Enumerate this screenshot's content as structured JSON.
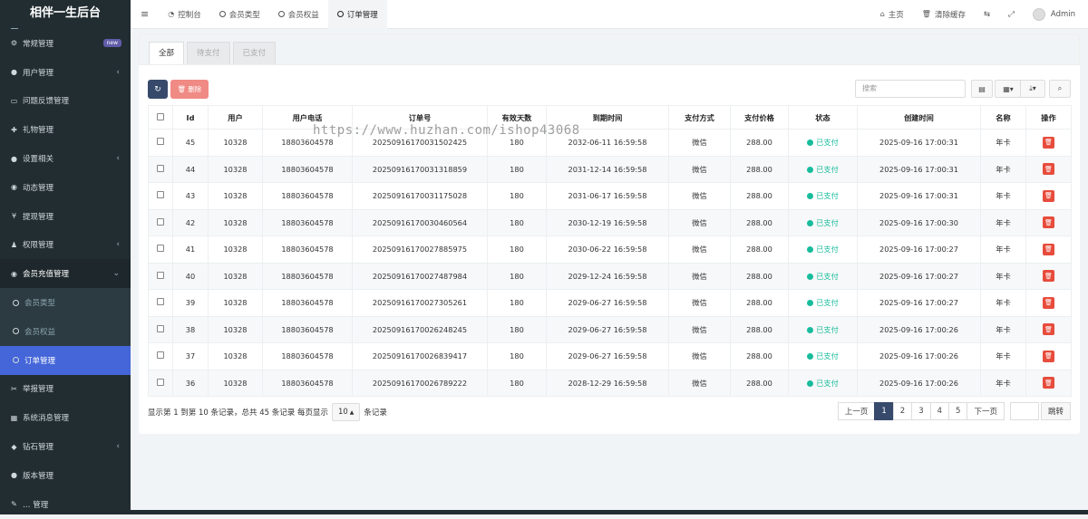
{
  "app_title": "相伴一生后台",
  "sidebar": {
    "items": [
      {
        "label": "常规管理",
        "icon": "gears-icon",
        "badge": "new"
      },
      {
        "label": "用户管理",
        "icon": "user-icon",
        "chev": "‹"
      },
      {
        "label": "问题反馈管理",
        "icon": "feedback-icon"
      },
      {
        "label": "礼物管理",
        "icon": "gift-icon"
      },
      {
        "label": "设置相关",
        "icon": "apple-icon",
        "chev": "‹"
      },
      {
        "label": "动态管理",
        "icon": "compass-icon"
      },
      {
        "label": "提现管理",
        "icon": "yen-icon"
      },
      {
        "label": "权限管理",
        "icon": "group-icon",
        "chev": "‹"
      },
      {
        "label": "会员充值管理",
        "icon": "dot-circle-icon",
        "chev": "⌄"
      }
    ],
    "sub_items": [
      {
        "label": "会员类型"
      },
      {
        "label": "会员权益"
      },
      {
        "label": "订单管理"
      }
    ],
    "items_after": [
      {
        "label": "举报管理",
        "icon": "scissors-icon"
      },
      {
        "label": "系统消息管理",
        "icon": "institution-icon"
      },
      {
        "label": "钻石管理",
        "icon": "diamond-icon",
        "chev": "‹"
      },
      {
        "label": "版本管理",
        "icon": "android-icon"
      },
      {
        "label": "… 管理",
        "icon": "misc-icon"
      }
    ]
  },
  "topbar": {
    "tabs": [
      {
        "label": "控制台",
        "icon": "dashboard-icon"
      },
      {
        "label": "会员类型",
        "icon": "circle-icon"
      },
      {
        "label": "会员权益",
        "icon": "circle-icon"
      },
      {
        "label": "订单管理",
        "icon": "circle-icon"
      }
    ],
    "home": "主页",
    "clear_cache": "清除缓存",
    "user": "Admin"
  },
  "content_tabs": [
    "全部",
    "待支付",
    "已支付"
  ],
  "toolbar": {
    "delete_label": "删除",
    "search_placeholder": "搜索"
  },
  "table": {
    "columns": [
      "Id",
      "用户",
      "用户电话",
      "订单号",
      "有效天数",
      "到期时间",
      "支付方式",
      "支付价格",
      "状态",
      "创建时间",
      "名称",
      "操作"
    ],
    "rows": [
      {
        "id": "45",
        "user": "10328",
        "phone": "18803604578",
        "order": "20250916170031502425",
        "days": "180",
        "expire": "2032-06-11 16:59:58",
        "pay": "微信",
        "price": "288.00",
        "status": "已支付",
        "created": "2025-09-16 17:00:31",
        "name": "年卡"
      },
      {
        "id": "44",
        "user": "10328",
        "phone": "18803604578",
        "order": "20250916170031318859",
        "days": "180",
        "expire": "2031-12-14 16:59:58",
        "pay": "微信",
        "price": "288.00",
        "status": "已支付",
        "created": "2025-09-16 17:00:31",
        "name": "年卡"
      },
      {
        "id": "43",
        "user": "10328",
        "phone": "18803604578",
        "order": "20250916170031175028",
        "days": "180",
        "expire": "2031-06-17 16:59:58",
        "pay": "微信",
        "price": "288.00",
        "status": "已支付",
        "created": "2025-09-16 17:00:31",
        "name": "年卡"
      },
      {
        "id": "42",
        "user": "10328",
        "phone": "18803604578",
        "order": "20250916170030460564",
        "days": "180",
        "expire": "2030-12-19 16:59:58",
        "pay": "微信",
        "price": "288.00",
        "status": "已支付",
        "created": "2025-09-16 17:00:30",
        "name": "年卡"
      },
      {
        "id": "41",
        "user": "10328",
        "phone": "18803604578",
        "order": "20250916170027885975",
        "days": "180",
        "expire": "2030-06-22 16:59:58",
        "pay": "微信",
        "price": "288.00",
        "status": "已支付",
        "created": "2025-09-16 17:00:27",
        "name": "年卡"
      },
      {
        "id": "40",
        "user": "10328",
        "phone": "18803604578",
        "order": "20250916170027487984",
        "days": "180",
        "expire": "2029-12-24 16:59:58",
        "pay": "微信",
        "price": "288.00",
        "status": "已支付",
        "created": "2025-09-16 17:00:27",
        "name": "年卡"
      },
      {
        "id": "39",
        "user": "10328",
        "phone": "18803604578",
        "order": "20250916170027305261",
        "days": "180",
        "expire": "2029-06-27 16:59:58",
        "pay": "微信",
        "price": "288.00",
        "status": "已支付",
        "created": "2025-09-16 17:00:27",
        "name": "年卡"
      },
      {
        "id": "38",
        "user": "10328",
        "phone": "18803604578",
        "order": "20250916170026248245",
        "days": "180",
        "expire": "2029-06-27 16:59:58",
        "pay": "微信",
        "price": "288.00",
        "status": "已支付",
        "created": "2025-09-16 17:00:26",
        "name": "年卡"
      },
      {
        "id": "37",
        "user": "10328",
        "phone": "18803604578",
        "order": "20250916170026839417",
        "days": "180",
        "expire": "2029-06-27 16:59:58",
        "pay": "微信",
        "price": "288.00",
        "status": "已支付",
        "created": "2025-09-16 17:00:26",
        "name": "年卡"
      },
      {
        "id": "36",
        "user": "10328",
        "phone": "18803604578",
        "order": "20250916170026789222",
        "days": "180",
        "expire": "2028-12-29 16:59:58",
        "pay": "微信",
        "price": "288.00",
        "status": "已支付",
        "created": "2025-09-16 17:00:26",
        "name": "年卡"
      }
    ]
  },
  "footer": {
    "summary": "显示第 1 到第 10 条记录，总共 45 条记录 每页显示",
    "page_size": "10",
    "suffix": "条记录",
    "prev": "上一页",
    "pages": [
      "1",
      "2",
      "3",
      "4",
      "5"
    ],
    "next": "下一页",
    "go": "跳转"
  },
  "watermark": "https://www.huzhan.com/ishop43068",
  "colors": {
    "sidebar_bg": "#222d32",
    "active": "#4466d8",
    "paid": "#18bc9c",
    "danger": "#e74c3c",
    "primary": "#374a6b"
  }
}
